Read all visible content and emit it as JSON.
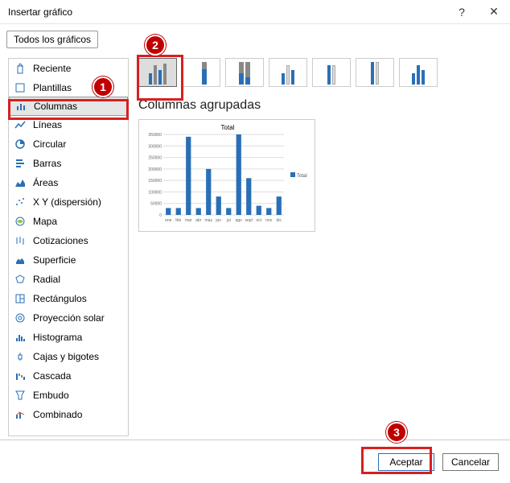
{
  "window": {
    "title": "Insertar gráfico"
  },
  "tab": {
    "all_charts": "Todos los gráficos"
  },
  "sidebar": {
    "items": [
      {
        "label": "Reciente"
      },
      {
        "label": "Plantillas"
      },
      {
        "label": "Columnas"
      },
      {
        "label": "Líneas"
      },
      {
        "label": "Circular"
      },
      {
        "label": "Barras"
      },
      {
        "label": "Áreas"
      },
      {
        "label": "X Y (dispersión)"
      },
      {
        "label": "Mapa"
      },
      {
        "label": "Cotizaciones"
      },
      {
        "label": "Superficie"
      },
      {
        "label": "Radial"
      },
      {
        "label": "Rectángulos"
      },
      {
        "label": "Proyección solar"
      },
      {
        "label": "Histograma"
      },
      {
        "label": "Cajas y bigotes"
      },
      {
        "label": "Cascada"
      },
      {
        "label": "Embudo"
      },
      {
        "label": "Combinado"
      }
    ]
  },
  "main": {
    "subtype_title": "Columnas agrupadas",
    "preview_title": "Total",
    "legend": "Total"
  },
  "footer": {
    "ok": "Aceptar",
    "cancel": "Cancelar"
  },
  "callouts": {
    "c1": "1",
    "c2": "2",
    "c3": "3"
  },
  "chart_data": {
    "type": "bar",
    "title": "Total",
    "categories": [
      "ene",
      "feb",
      "mar",
      "abr",
      "may",
      "jun",
      "jul",
      "ago",
      "sept",
      "oct",
      "nov",
      "dic"
    ],
    "values": [
      30000,
      30000,
      340000,
      30000,
      200000,
      80000,
      30000,
      350000,
      160000,
      40000,
      30000,
      80000
    ],
    "ylim": [
      0,
      350000
    ],
    "yticks": [
      0,
      50000,
      100000,
      150000,
      200000,
      250000,
      300000,
      350000
    ],
    "series": [
      {
        "name": "Total"
      }
    ]
  }
}
